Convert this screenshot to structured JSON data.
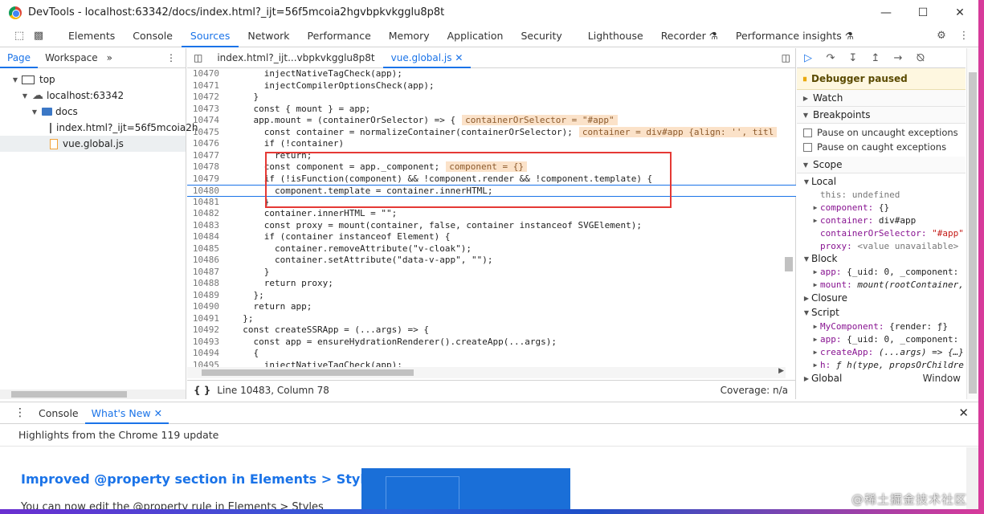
{
  "window": {
    "title": "DevTools - localhost:63342/docs/index.html?_ijt=56f5mcoia2hgvbpkvkgglu8p8t"
  },
  "panel_tabs": [
    {
      "label": "Elements"
    },
    {
      "label": "Console"
    },
    {
      "label": "Sources"
    },
    {
      "label": "Network"
    },
    {
      "label": "Performance"
    },
    {
      "label": "Memory"
    },
    {
      "label": "Application"
    },
    {
      "label": "Security"
    },
    {
      "label": "Lighthouse"
    },
    {
      "label": "Recorder ⚗"
    },
    {
      "label": "Performance insights ⚗"
    }
  ],
  "navigator": {
    "tabs": [
      "Page",
      "Workspace"
    ],
    "tree": [
      "top",
      "localhost:63342",
      "docs",
      "index.html?_ijt=56f5mcoia2h",
      "vue.global.js"
    ]
  },
  "editor": {
    "tabs": [
      "index.html?_ijt...vbpkvkgglu8p8t",
      "vue.global.js"
    ],
    "lines": [
      {
        "n": "10470",
        "t": "      injectNativeTagCheck(app);"
      },
      {
        "n": "10471",
        "t": "      injectCompilerOptionsCheck(app);"
      },
      {
        "n": "10472",
        "t": "    }"
      },
      {
        "n": "10473",
        "t": "    const { mount } = app;"
      },
      {
        "n": "10474",
        "t": "    app.mount = (containerOrSelector) => {",
        "inline": "containerOrSelector = \"#app\""
      },
      {
        "n": "10475",
        "t": "      const container = normalizeContainer(containerOrSelector);",
        "inline": "container = div#app {align: '', titl"
      },
      {
        "n": "10476",
        "t": "      if (!container)"
      },
      {
        "n": "10477",
        "t": "        return;"
      },
      {
        "n": "10478",
        "t": "      const component = app._component;",
        "inline": "component = {}"
      },
      {
        "n": "10479",
        "t": "      if (!isFunction(component) && !component.render && !component.template) {"
      },
      {
        "n": "10480",
        "t": "        component.template = container.innerHTML;"
      },
      {
        "n": "10481",
        "t": "      }"
      },
      {
        "n": "10482",
        "t": "      container.innerHTML = \"\";"
      },
      {
        "n": "10483",
        "t": "      const proxy = mount(container, false, container instanceof SVGElement);"
      },
      {
        "n": "10484",
        "t": "      if (container instanceof Element) {"
      },
      {
        "n": "10485",
        "t": "        container.removeAttribute(\"v-cloak\");"
      },
      {
        "n": "10486",
        "t": "        container.setAttribute(\"data-v-app\", \"\");"
      },
      {
        "n": "10487",
        "t": "      }"
      },
      {
        "n": "10488",
        "t": "      return proxy;"
      },
      {
        "n": "10489",
        "t": "    };"
      },
      {
        "n": "10490",
        "t": "    return app;"
      },
      {
        "n": "10491",
        "t": "  };"
      },
      {
        "n": "10492",
        "t": "  const createSSRApp = (...args) => {"
      },
      {
        "n": "10493",
        "t": "    const app = ensureHydrationRenderer().createApp(...args);"
      },
      {
        "n": "10494",
        "t": "    {"
      },
      {
        "n": "10495",
        "t": "      injectNativeTagCheck(app);"
      }
    ],
    "status": {
      "position": "Line 10483, Column 78",
      "coverage": "Coverage: n/a"
    }
  },
  "debugger": {
    "paused": "Debugger paused",
    "sections": {
      "watch": "Watch",
      "breakpoints": "Breakpoints",
      "scope": "Scope",
      "local": "Local",
      "block": "Block",
      "closure": "Closure",
      "script": "Script",
      "global": "Global",
      "global_val": "Window"
    },
    "checkboxes": [
      "Pause on uncaught exceptions",
      "Pause on caught exceptions"
    ],
    "local": [
      {
        "k": "this:",
        "v": "undefined"
      },
      {
        "k": "component:",
        "v": "{}"
      },
      {
        "k": "container:",
        "v": "div#app"
      },
      {
        "k": "containerOrSelector:",
        "v": "\"#app\""
      },
      {
        "k": "proxy:",
        "v": "<value unavailable>"
      }
    ],
    "block": [
      {
        "k": "app:",
        "v": "{_uid: 0, _component: "
      },
      {
        "k": "mount:",
        "v": "mount(rootContainer, "
      }
    ],
    "script": [
      {
        "k": "MyComponent:",
        "v": "{render: ƒ}"
      },
      {
        "k": "app:",
        "v": "{_uid: 0, _component: "
      },
      {
        "k": "createApp:",
        "v": "(...args) => {…}"
      },
      {
        "k": "h:",
        "v": "ƒ h(type, propsOrChildre"
      }
    ]
  },
  "drawer": {
    "tabs": [
      "Console",
      "What's New"
    ],
    "highlights": "Highlights from the Chrome 119 update",
    "heading": "Improved @property section in Elements > Styles",
    "body": "You can now edit the @property rule in Elements > Styles"
  },
  "watermark": "@稀土掘金技术社区"
}
